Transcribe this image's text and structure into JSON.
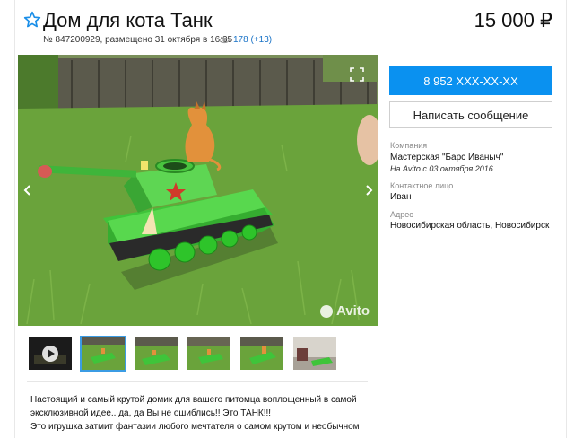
{
  "listing": {
    "title": "Дом для кота Танк",
    "price": "15 000 ₽",
    "meta": "№ 847200929, размещено 31 октября в 16:35",
    "views": "178 (+13)"
  },
  "gallery": {
    "watermark": "Avito",
    "thumbnails": 6,
    "selected_index": 1
  },
  "contact": {
    "phone_button": "8 952 XXX-XX-XX",
    "message_button": "Написать сообщение",
    "company_label": "Компания",
    "company_name": "Мастерская \"Барс Иваныч\"",
    "company_since": "На Avito с 03 октября 2016",
    "person_label": "Контактное лицо",
    "person_name": "Иван",
    "address_label": "Адрес",
    "address": "Новосибирская область, Новосибирск"
  },
  "description": {
    "line1": "Настоящий и самый крутой домик для вашего питомца воплощенный в самой",
    "line2": "эксклюзивной идее.. да, да Вы не ошиблись!! Это ТАНК!!!",
    "line3": "Это игрушка затмит фантазии любого мечтателя о самом крутом и необычном"
  },
  "colors": {
    "accent": "#0a91f0",
    "link": "#1a73c7",
    "tank_green": "#3fc43a"
  }
}
